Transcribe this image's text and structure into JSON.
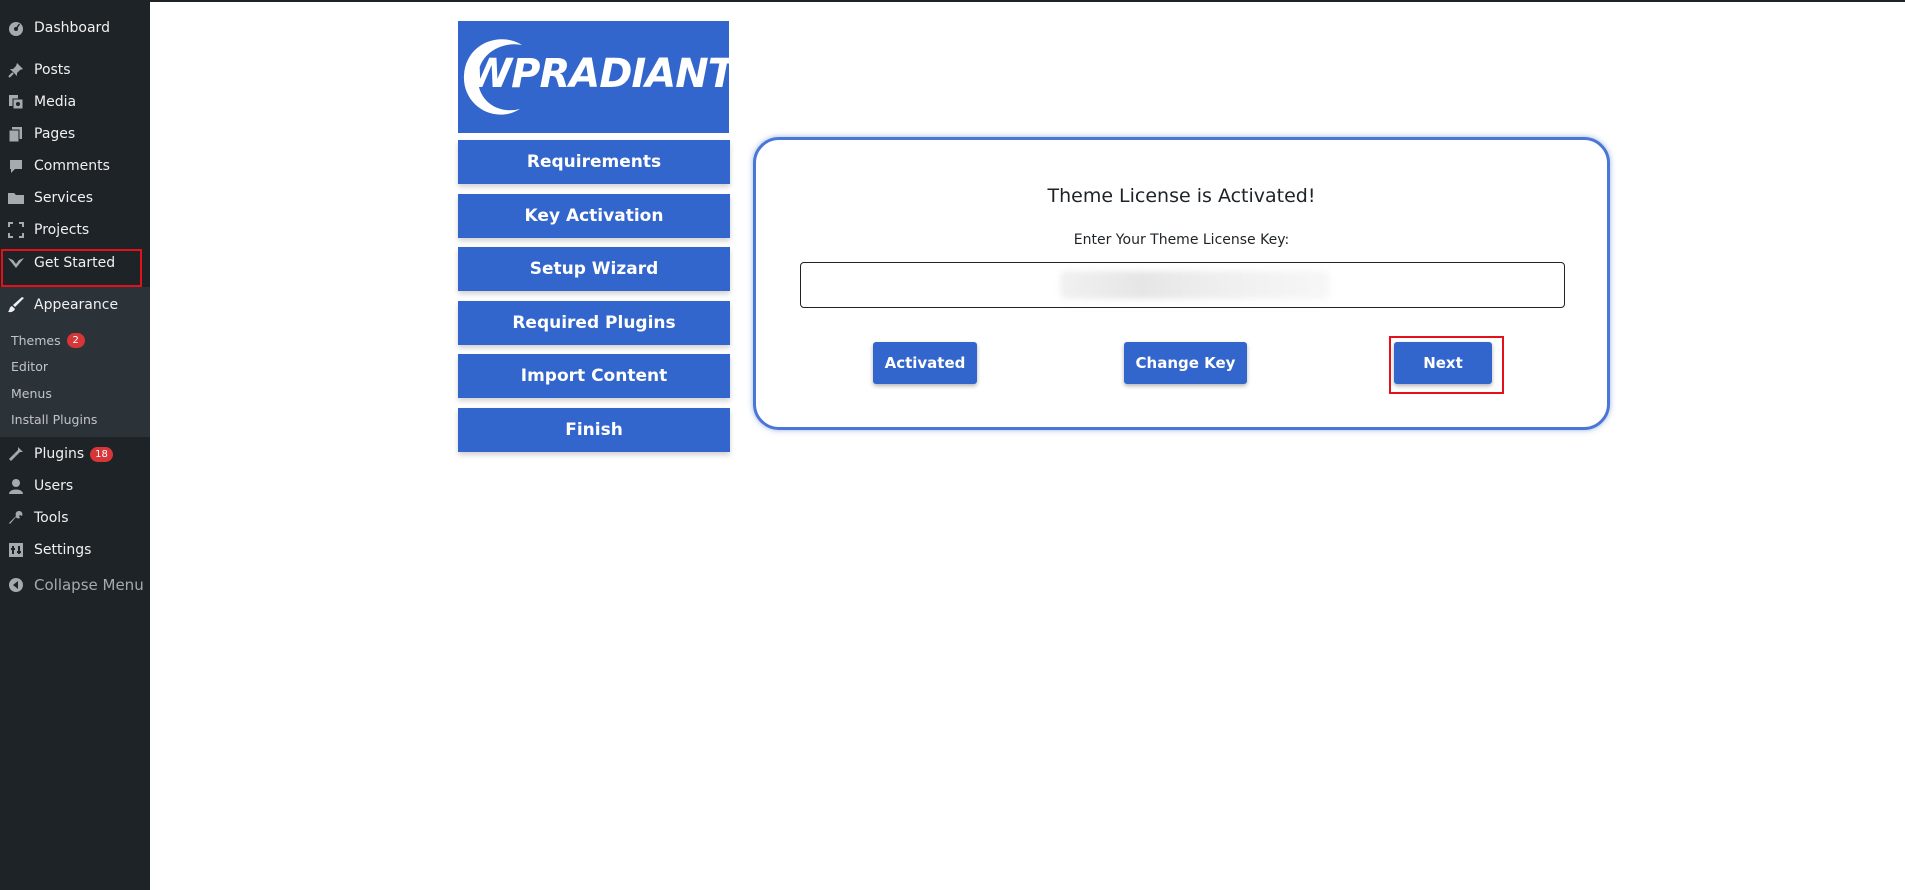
{
  "sidebar": {
    "items": [
      {
        "label": "Dashboard",
        "icon": "dashboard-icon"
      },
      {
        "label": "Posts",
        "icon": "pushpin-icon"
      },
      {
        "label": "Media",
        "icon": "media-icon"
      },
      {
        "label": "Pages",
        "icon": "pages-icon"
      },
      {
        "label": "Comments",
        "icon": "comment-icon"
      },
      {
        "label": "Services",
        "icon": "folder-icon"
      },
      {
        "label": "Projects",
        "icon": "expand-icon"
      },
      {
        "label": "Get Started",
        "icon": "chevron-logo-icon"
      },
      {
        "label": "Appearance",
        "icon": "paintbrush-icon"
      },
      {
        "label": "Plugins",
        "icon": "plug-icon",
        "badge": "18"
      },
      {
        "label": "Users",
        "icon": "user-icon"
      },
      {
        "label": "Tools",
        "icon": "wrench-icon"
      },
      {
        "label": "Settings",
        "icon": "settings-icon"
      },
      {
        "label": "Collapse Menu",
        "icon": "collapse-arrow-icon"
      }
    ],
    "appearance_submenu": [
      {
        "label": "Themes",
        "badge": "2"
      },
      {
        "label": "Editor"
      },
      {
        "label": "Menus"
      },
      {
        "label": "Install Plugins"
      }
    ]
  },
  "wizard": {
    "logo_text": "WPRADIANT",
    "nav": [
      "Requirements",
      "Key Activation",
      "Setup Wizard",
      "Required Plugins",
      "Import Content",
      "Finish"
    ]
  },
  "license": {
    "title": "Theme License is Activated!",
    "prompt": "Enter Your Theme License Key:",
    "key_value": "Y",
    "buttons": {
      "activated": "Activated",
      "change_key": "Change Key",
      "next": "Next"
    }
  },
  "colors": {
    "sidebar_bg": "#1d2327",
    "submenu_bg": "#2c3338",
    "brand_blue": "#3366cc",
    "highlight_red": "#e4111b",
    "badge_red": "#d63638"
  }
}
